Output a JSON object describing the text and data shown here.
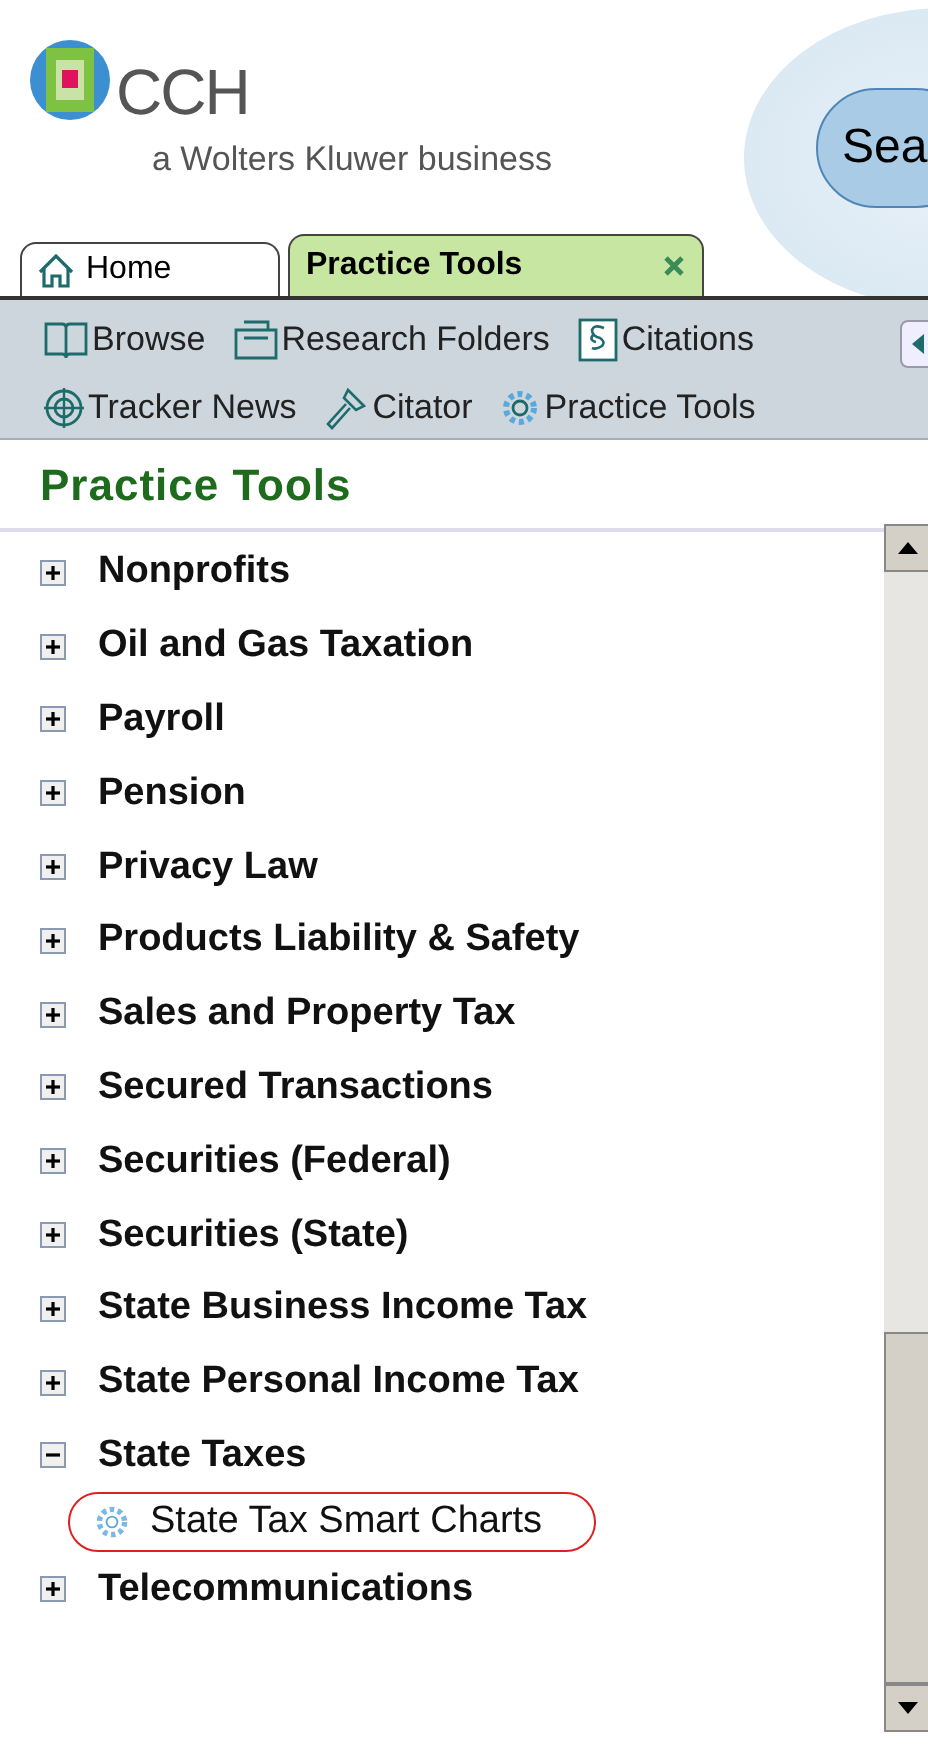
{
  "logo": {
    "name": "CCH",
    "tagline": "a Wolters Kluwer business"
  },
  "search_button": {
    "label": "Sea"
  },
  "tabs": [
    {
      "label": "Home",
      "selected": false
    },
    {
      "label": "Practice Tools",
      "selected": true
    }
  ],
  "toolbar": [
    {
      "label": "Browse"
    },
    {
      "label": "Research Folders"
    },
    {
      "label": "Citations"
    },
    {
      "label": "Tracker News"
    },
    {
      "label": "Citator"
    },
    {
      "label": "Practice Tools"
    }
  ],
  "section_title": "Practice Tools",
  "tree": [
    {
      "label": "Nonprofits",
      "expanded": false
    },
    {
      "label": "Oil and Gas Taxation",
      "expanded": false
    },
    {
      "label": "Payroll",
      "expanded": false
    },
    {
      "label": "Pension",
      "expanded": false
    },
    {
      "label": "Privacy Law",
      "expanded": false
    },
    {
      "label": "Products Liability & Safety",
      "expanded": false
    },
    {
      "label": "Sales and Property Tax",
      "expanded": false
    },
    {
      "label": "Secured Transactions",
      "expanded": false
    },
    {
      "label": "Securities (Federal)",
      "expanded": false
    },
    {
      "label": "Securities (State)",
      "expanded": false
    },
    {
      "label": "State Business Income Tax",
      "expanded": false
    },
    {
      "label": "State Personal Income Tax",
      "expanded": false
    },
    {
      "label": "State Taxes",
      "expanded": true,
      "children": [
        {
          "label": "State Tax Smart Charts",
          "highlighted": true
        }
      ]
    },
    {
      "label": "Telecommunications",
      "expanded": false
    }
  ]
}
